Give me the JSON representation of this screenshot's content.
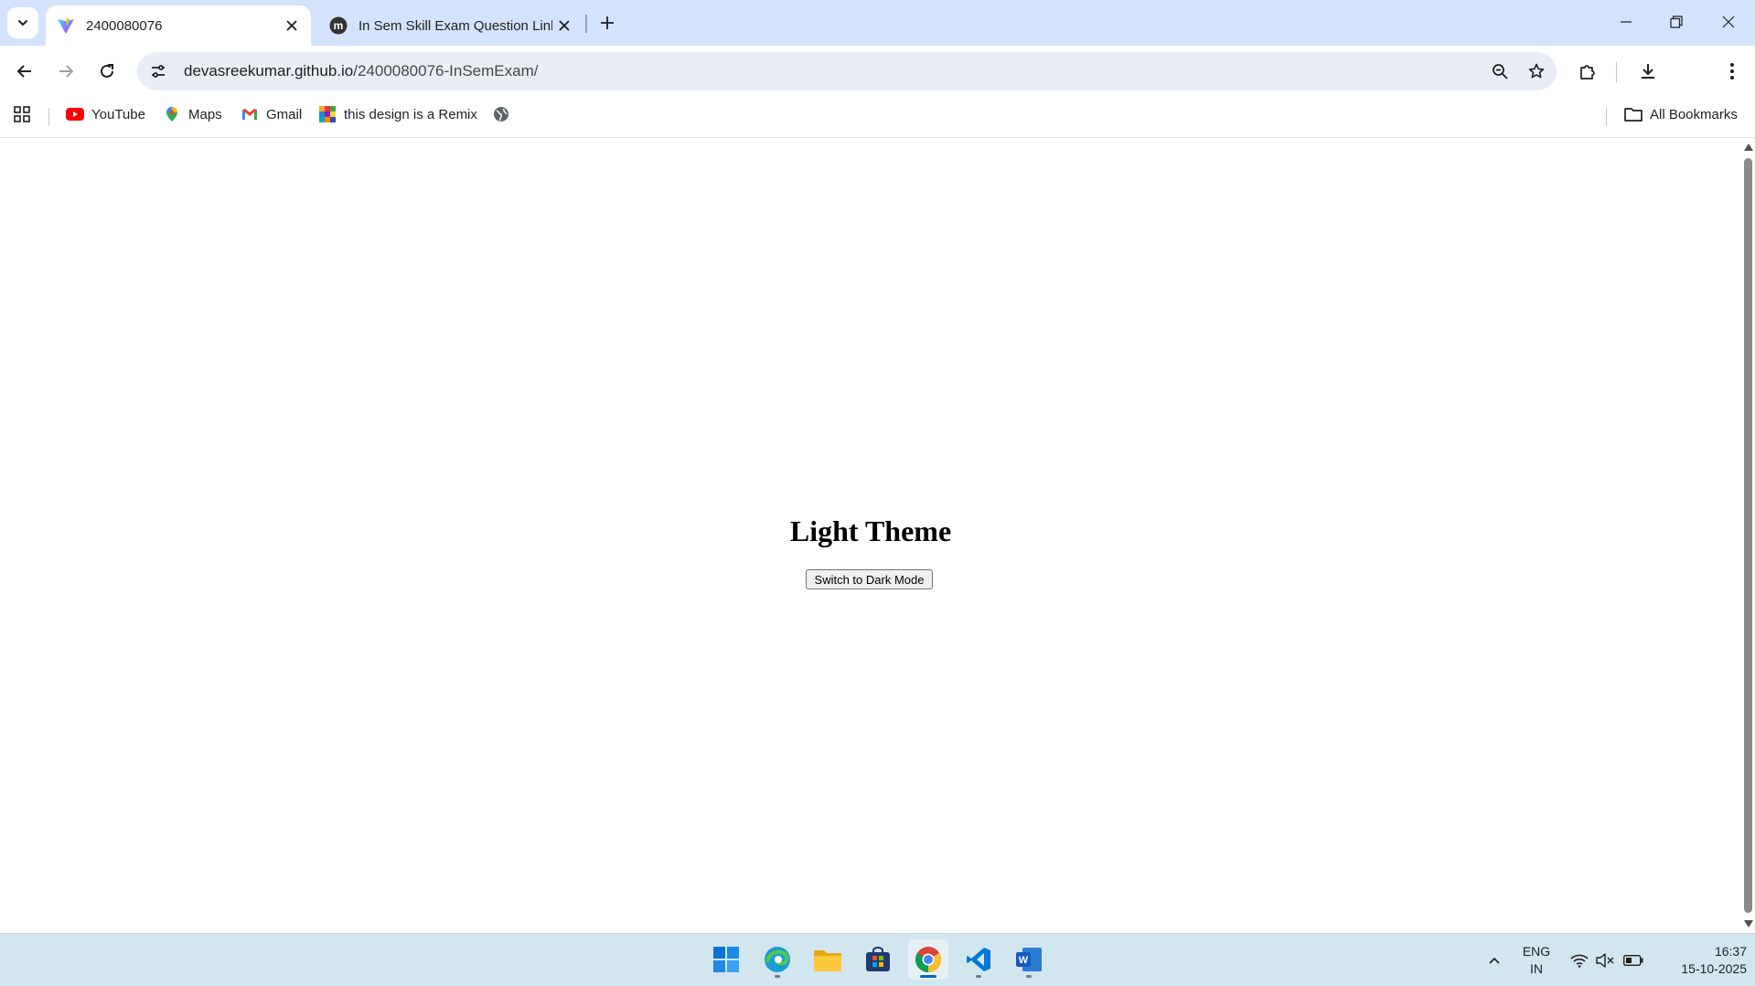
{
  "browser": {
    "tabs": [
      {
        "title": "2400080076",
        "active": true,
        "favicon": "vite-logo-icon"
      },
      {
        "title": "In Sem Skill Exam Question Link",
        "active": false,
        "favicon": "moodle-logo-icon"
      }
    ],
    "address": {
      "host": "devasreekumar.github.io",
      "path": "/2400080076-InSemExam/"
    },
    "bookmarks": [
      {
        "label": "YouTube",
        "icon": "youtube-icon"
      },
      {
        "label": "Maps",
        "icon": "maps-icon"
      },
      {
        "label": "Gmail",
        "icon": "gmail-icon"
      },
      {
        "label": "this design is a Remix",
        "icon": "grid-favicon-icon"
      }
    ],
    "all_bookmarks_label": "All Bookmarks"
  },
  "page": {
    "heading": "Light Theme",
    "toggle_button": "Switch to Dark Mode"
  },
  "taskbar": {
    "apps": [
      {
        "name": "start",
        "icon": "windows-start-icon"
      },
      {
        "name": "edge",
        "icon": "edge-icon"
      },
      {
        "name": "file-explorer",
        "icon": "folder-icon"
      },
      {
        "name": "store",
        "icon": "store-icon"
      },
      {
        "name": "chrome",
        "icon": "chrome-icon",
        "active": true
      },
      {
        "name": "vscode",
        "icon": "vscode-icon"
      },
      {
        "name": "word",
        "icon": "word-icon"
      }
    ],
    "language": {
      "line1": "ENG",
      "line2": "IN"
    },
    "time": "16:37",
    "date": "15-10-2025"
  },
  "colors": {
    "tabstrip": "#d3e3fd",
    "omnibox": "#e9eef6",
    "taskbar": "#d1e6ee",
    "accent": "#0067c0"
  }
}
